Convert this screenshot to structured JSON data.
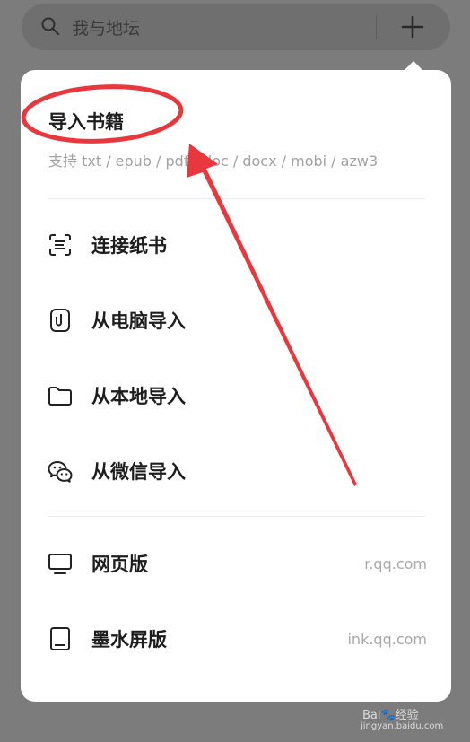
{
  "search": {
    "placeholder_text": "我与地坛"
  },
  "popup": {
    "title": "导入书籍",
    "formats": "支持 txt / epub / pdf / doc / docx / mobi / azw3",
    "items": [
      {
        "label": "连接纸书",
        "icon": "scan-icon"
      },
      {
        "label": "从电脑导入",
        "icon": "clip-icon"
      },
      {
        "label": "从本地导入",
        "icon": "folder-icon"
      },
      {
        "label": "从微信导入",
        "icon": "wechat-icon"
      }
    ],
    "links": [
      {
        "label": "网页版",
        "url_text": "r.qq.com",
        "icon": "monitor-icon"
      },
      {
        "label": "墨水屏版",
        "url_text": "ink.qq.com",
        "icon": "tablet-icon"
      }
    ]
  },
  "watermark": {
    "text": "Bai🐾经验",
    "sub": "jingyan.baidu.com"
  },
  "colors": {
    "annotation_red": "#e8383d",
    "overlay_gray": "#7c7c7c",
    "card_white": "#ffffff"
  }
}
